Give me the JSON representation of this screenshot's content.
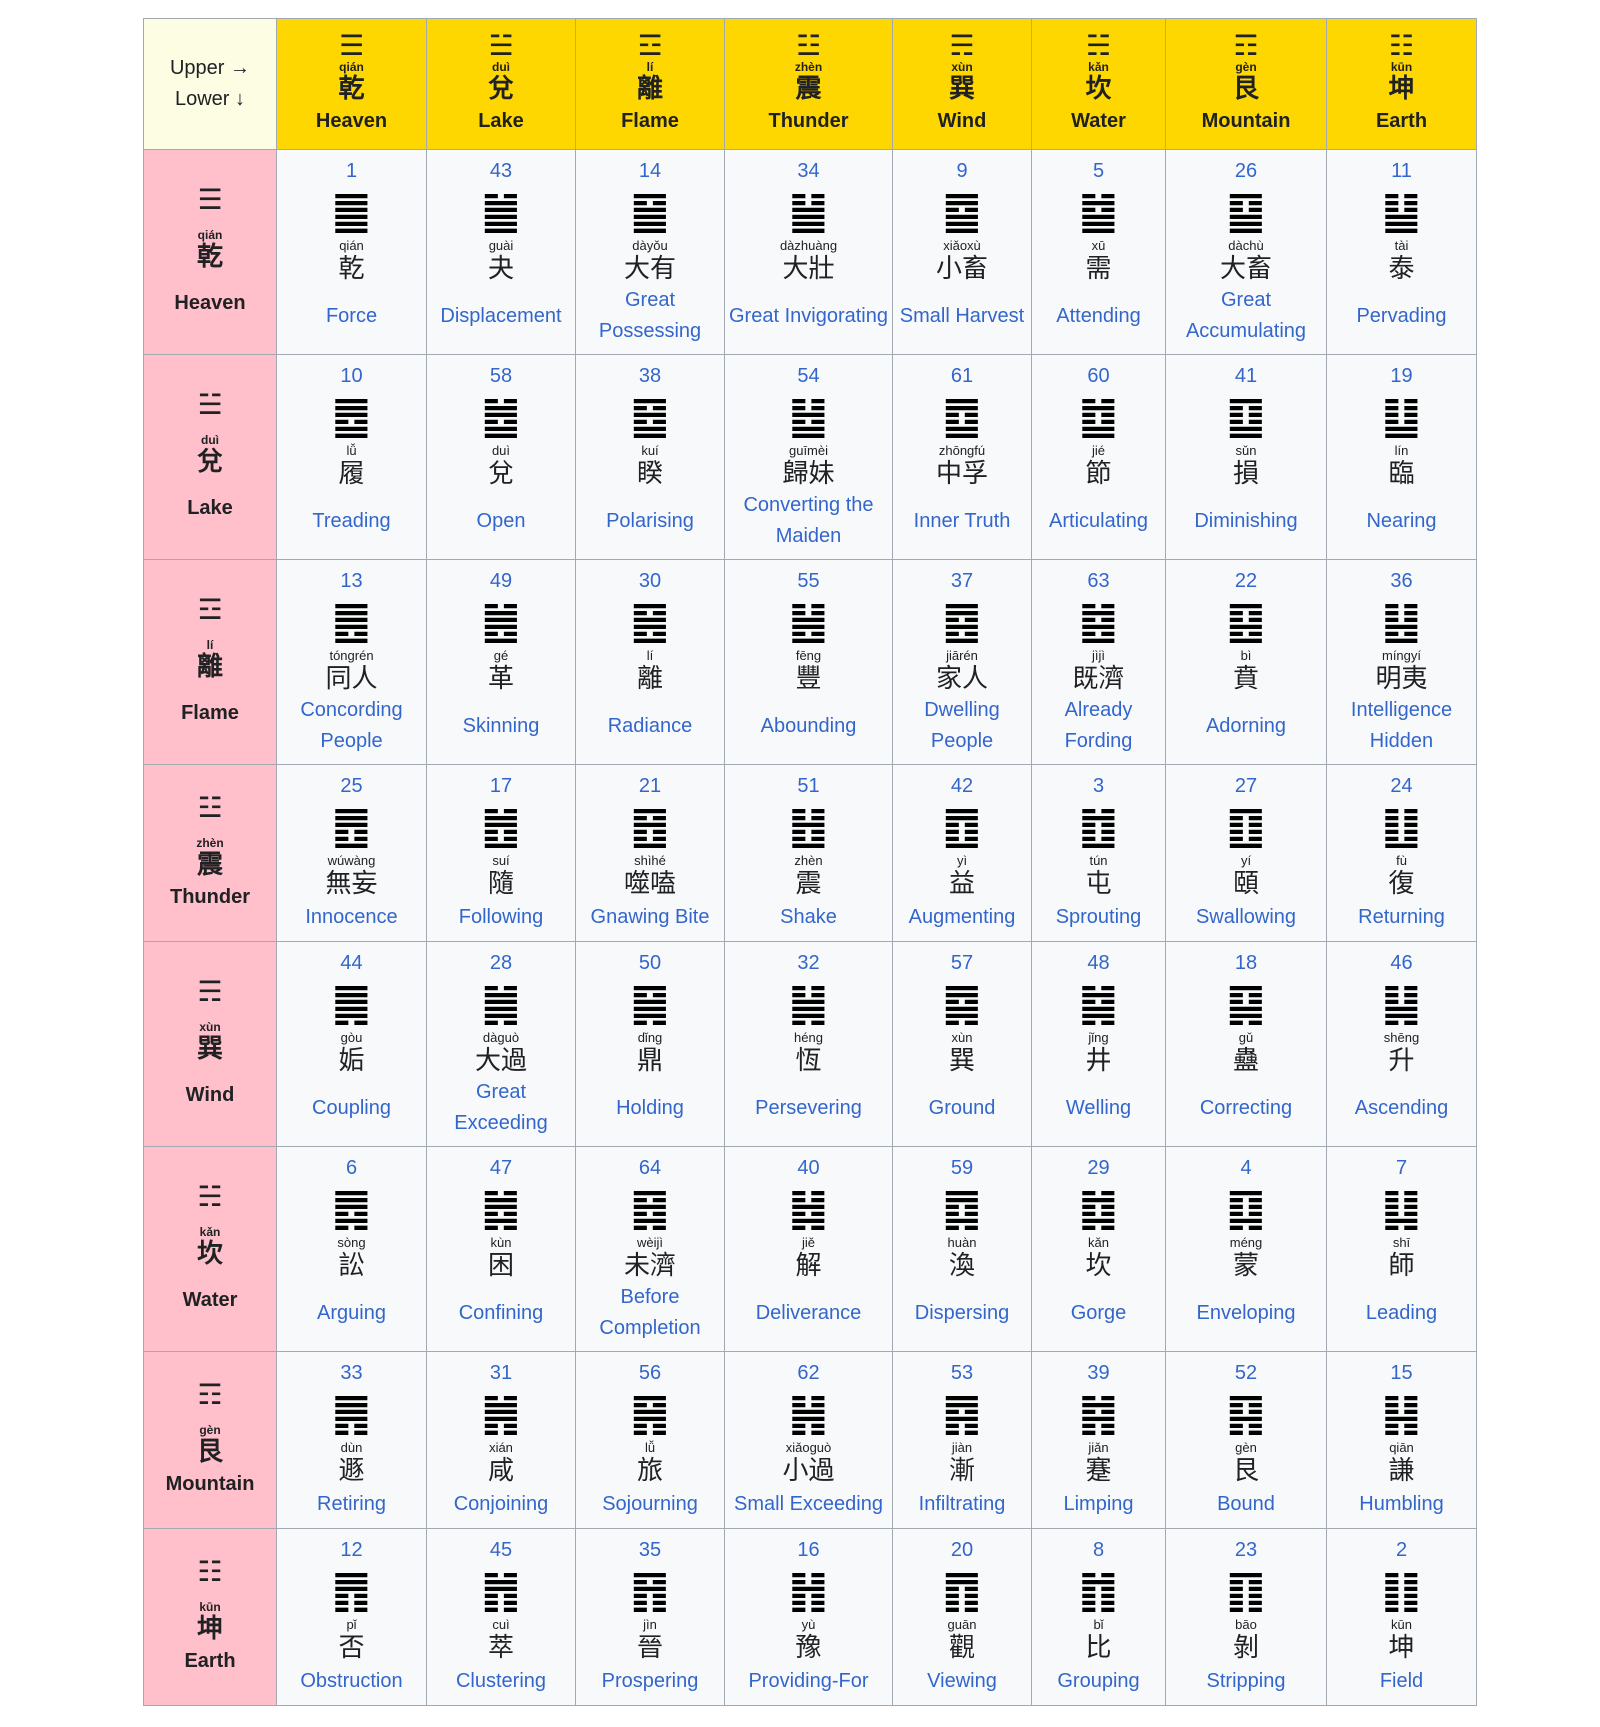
{
  "corner": {
    "upper": "Upper →",
    "lower": "Lower ↓"
  },
  "trigrams": [
    {
      "symbol": "☰",
      "pinyin": "qián",
      "zh": "乾",
      "en": "Heaven"
    },
    {
      "symbol": "☱",
      "pinyin": "duì",
      "zh": "兌",
      "en": "Lake"
    },
    {
      "symbol": "☲",
      "pinyin": "lí",
      "zh": "離",
      "en": "Flame"
    },
    {
      "symbol": "☳",
      "pinyin": "zhèn",
      "zh": "震",
      "en": "Thunder"
    },
    {
      "symbol": "☴",
      "pinyin": "xùn",
      "zh": "巽",
      "en": "Wind"
    },
    {
      "symbol": "☵",
      "pinyin": "kǎn",
      "zh": "坎",
      "en": "Water"
    },
    {
      "symbol": "☶",
      "pinyin": "gèn",
      "zh": "艮",
      "en": "Mountain"
    },
    {
      "symbol": "☷",
      "pinyin": "kūn",
      "zh": "坤",
      "en": "Earth"
    }
  ],
  "rows": [
    [
      {
        "num": "1",
        "glyph": "䷀",
        "pinyin": "qián",
        "zh": "乾",
        "en": "Force"
      },
      {
        "num": "43",
        "glyph": "䷪",
        "pinyin": "guài",
        "zh": "夬",
        "en": "Displacement"
      },
      {
        "num": "14",
        "glyph": "䷍",
        "pinyin": "dàyǒu",
        "zh": "大有",
        "en": "Great Possessing"
      },
      {
        "num": "34",
        "glyph": "䷡",
        "pinyin": "dàzhuàng",
        "zh": "大壯",
        "en": "Great Invigorating"
      },
      {
        "num": "9",
        "glyph": "䷈",
        "pinyin": "xiǎoxù",
        "zh": "小畜",
        "en": "Small Harvest"
      },
      {
        "num": "5",
        "glyph": "䷄",
        "pinyin": "xū",
        "zh": "需",
        "en": "Attending"
      },
      {
        "num": "26",
        "glyph": "䷙",
        "pinyin": "dàchù",
        "zh": "大畜",
        "en": "Great Accumulating"
      },
      {
        "num": "11",
        "glyph": "䷊",
        "pinyin": "tài",
        "zh": "泰",
        "en": "Pervading"
      }
    ],
    [
      {
        "num": "10",
        "glyph": "䷉",
        "pinyin": "lǚ",
        "zh": "履",
        "en": "Treading"
      },
      {
        "num": "58",
        "glyph": "䷹",
        "pinyin": "duì",
        "zh": "兌",
        "en": "Open"
      },
      {
        "num": "38",
        "glyph": "䷥",
        "pinyin": "kuí",
        "zh": "睽",
        "en": "Polarising"
      },
      {
        "num": "54",
        "glyph": "䷵",
        "pinyin": "guīmèi",
        "zh": "歸妹",
        "en": "Converting the Maiden"
      },
      {
        "num": "61",
        "glyph": "䷼",
        "pinyin": "zhōngfú",
        "zh": "中孚",
        "en": "Inner Truth"
      },
      {
        "num": "60",
        "glyph": "䷻",
        "pinyin": "jié",
        "zh": "節",
        "en": "Articulating"
      },
      {
        "num": "41",
        "glyph": "䷨",
        "pinyin": "sǔn",
        "zh": "損",
        "en": "Diminishing"
      },
      {
        "num": "19",
        "glyph": "䷒",
        "pinyin": "lín",
        "zh": "臨",
        "en": "Nearing"
      }
    ],
    [
      {
        "num": "13",
        "glyph": "䷌",
        "pinyin": "tóngrén",
        "zh": "同人",
        "en": "Concording People"
      },
      {
        "num": "49",
        "glyph": "䷰",
        "pinyin": "gé",
        "zh": "革",
        "en": "Skinning"
      },
      {
        "num": "30",
        "glyph": "䷝",
        "pinyin": "lí",
        "zh": "離",
        "en": "Radiance"
      },
      {
        "num": "55",
        "glyph": "䷶",
        "pinyin": "fēng",
        "zh": "豐",
        "en": "Abounding"
      },
      {
        "num": "37",
        "glyph": "䷤",
        "pinyin": "jiārén",
        "zh": "家人",
        "en": "Dwelling People"
      },
      {
        "num": "63",
        "glyph": "䷾",
        "pinyin": "jìjì",
        "zh": "既濟",
        "en": "Already Fording"
      },
      {
        "num": "22",
        "glyph": "䷕",
        "pinyin": "bì",
        "zh": "賁",
        "en": "Adorning"
      },
      {
        "num": "36",
        "glyph": "䷣",
        "pinyin": "míngyí",
        "zh": "明夷",
        "en": "Intelligence Hidden"
      }
    ],
    [
      {
        "num": "25",
        "glyph": "䷘",
        "pinyin": "wúwàng",
        "zh": "無妄",
        "en": "Innocence"
      },
      {
        "num": "17",
        "glyph": "䷐",
        "pinyin": "suí",
        "zh": "隨",
        "en": "Following"
      },
      {
        "num": "21",
        "glyph": "䷔",
        "pinyin": "shìhé",
        "zh": "噬嗑",
        "en": "Gnawing Bite"
      },
      {
        "num": "51",
        "glyph": "䷲",
        "pinyin": "zhèn",
        "zh": "震",
        "en": "Shake"
      },
      {
        "num": "42",
        "glyph": "䷩",
        "pinyin": "yì",
        "zh": "益",
        "en": "Augmenting"
      },
      {
        "num": "3",
        "glyph": "䷂",
        "pinyin": "tún",
        "zh": "屯",
        "en": "Sprouting"
      },
      {
        "num": "27",
        "glyph": "䷚",
        "pinyin": "yí",
        "zh": "頤",
        "en": "Swallowing"
      },
      {
        "num": "24",
        "glyph": "䷗",
        "pinyin": "fù",
        "zh": "復",
        "en": "Returning"
      }
    ],
    [
      {
        "num": "44",
        "glyph": "䷫",
        "pinyin": "gòu",
        "zh": "姤",
        "en": "Coupling"
      },
      {
        "num": "28",
        "glyph": "䷛",
        "pinyin": "dàguò",
        "zh": "大過",
        "en": "Great Exceeding"
      },
      {
        "num": "50",
        "glyph": "䷱",
        "pinyin": "dǐng",
        "zh": "鼎",
        "en": "Holding"
      },
      {
        "num": "32",
        "glyph": "䷟",
        "pinyin": "héng",
        "zh": "恆",
        "en": "Persevering"
      },
      {
        "num": "57",
        "glyph": "䷸",
        "pinyin": "xùn",
        "zh": "巽",
        "en": "Ground"
      },
      {
        "num": "48",
        "glyph": "䷯",
        "pinyin": "jǐng",
        "zh": "井",
        "en": "Welling"
      },
      {
        "num": "18",
        "glyph": "䷑",
        "pinyin": "gǔ",
        "zh": "蠱",
        "en": "Correcting"
      },
      {
        "num": "46",
        "glyph": "䷭",
        "pinyin": "shēng",
        "zh": "升",
        "en": "Ascending"
      }
    ],
    [
      {
        "num": "6",
        "glyph": "䷅",
        "pinyin": "sòng",
        "zh": "訟",
        "en": "Arguing"
      },
      {
        "num": "47",
        "glyph": "䷮",
        "pinyin": "kùn",
        "zh": "困",
        "en": "Confining"
      },
      {
        "num": "64",
        "glyph": "䷿",
        "pinyin": "wèijì",
        "zh": "未濟",
        "en": "Before Completion"
      },
      {
        "num": "40",
        "glyph": "䷧",
        "pinyin": "jiě",
        "zh": "解",
        "en": "Deliverance"
      },
      {
        "num": "59",
        "glyph": "䷺",
        "pinyin": "huàn",
        "zh": "渙",
        "en": "Dispersing"
      },
      {
        "num": "29",
        "glyph": "䷜",
        "pinyin": "kǎn",
        "zh": "坎",
        "en": "Gorge"
      },
      {
        "num": "4",
        "glyph": "䷃",
        "pinyin": "méng",
        "zh": "蒙",
        "en": "Enveloping"
      },
      {
        "num": "7",
        "glyph": "䷆",
        "pinyin": "shī",
        "zh": "師",
        "en": "Leading"
      }
    ],
    [
      {
        "num": "33",
        "glyph": "䷠",
        "pinyin": "dùn",
        "zh": "遯",
        "en": "Retiring"
      },
      {
        "num": "31",
        "glyph": "䷞",
        "pinyin": "xián",
        "zh": "咸",
        "en": "Conjoining"
      },
      {
        "num": "56",
        "glyph": "䷷",
        "pinyin": "lǚ",
        "zh": "旅",
        "en": "Sojourning"
      },
      {
        "num": "62",
        "glyph": "䷽",
        "pinyin": "xiǎoguò",
        "zh": "小過",
        "en": "Small Exceeding"
      },
      {
        "num": "53",
        "glyph": "䷴",
        "pinyin": "jiàn",
        "zh": "漸",
        "en": "Infiltrating"
      },
      {
        "num": "39",
        "glyph": "䷦",
        "pinyin": "jiǎn",
        "zh": "蹇",
        "en": "Limping"
      },
      {
        "num": "52",
        "glyph": "䷳",
        "pinyin": "gèn",
        "zh": "艮",
        "en": "Bound"
      },
      {
        "num": "15",
        "glyph": "䷎",
        "pinyin": "qiān",
        "zh": "謙",
        "en": "Humbling"
      }
    ],
    [
      {
        "num": "12",
        "glyph": "䷋",
        "pinyin": "pǐ",
        "zh": "否",
        "en": "Obstruction"
      },
      {
        "num": "45",
        "glyph": "䷬",
        "pinyin": "cuì",
        "zh": "萃",
        "en": "Clustering"
      },
      {
        "num": "35",
        "glyph": "䷢",
        "pinyin": "jìn",
        "zh": "晉",
        "en": "Prospering"
      },
      {
        "num": "16",
        "glyph": "䷏",
        "pinyin": "yù",
        "zh": "豫",
        "en": "Providing-For"
      },
      {
        "num": "20",
        "glyph": "䷓",
        "pinyin": "guān",
        "zh": "觀",
        "en": "Viewing"
      },
      {
        "num": "8",
        "glyph": "䷇",
        "pinyin": "bǐ",
        "zh": "比",
        "en": "Grouping"
      },
      {
        "num": "23",
        "glyph": "䷖",
        "pinyin": "bāo",
        "zh": "剝",
        "en": "Stripping"
      },
      {
        "num": "2",
        "glyph": "䷁",
        "pinyin": "kūn",
        "zh": "坤",
        "en": "Field"
      }
    ]
  ]
}
